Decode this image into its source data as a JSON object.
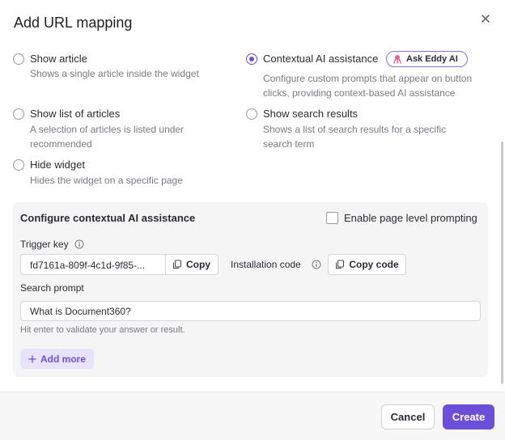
{
  "dialog": {
    "title": "Add URL mapping",
    "close_icon": "close-icon"
  },
  "options": [
    {
      "title": "Show article",
      "desc": "Shows a single article inside the widget",
      "selected": false
    },
    {
      "title": "Contextual AI assistance",
      "desc": "Configure custom prompts that appear on button clicks, providing context-based AI assistance",
      "selected": true
    },
    {
      "title": "Show list of articles",
      "desc": "A selection of articles is listed under recommended",
      "selected": false
    },
    {
      "title": "Show search results",
      "desc": "Shows a list of search results for a specific search term",
      "selected": false
    },
    {
      "title": "Hide widget",
      "desc": "Hides the widget on a specific page",
      "selected": false
    }
  ],
  "badge": {
    "label": "Ask Eddy AI",
    "icon": "eddy-ai-icon"
  },
  "panel": {
    "title": "Configure contextual AI assistance",
    "page_level_label": "Enable page level prompting",
    "page_level_checked": false,
    "trigger_key_label": "Trigger key",
    "trigger_key_value": "fd7161a-809f-4c1d-9f85-...",
    "copy_label": "Copy",
    "installation_code_label": "Installation code",
    "copy_code_label": "Copy code",
    "search_prompt_label": "Search prompt",
    "search_prompt_value": "What is Document360?",
    "hint": "Hit enter to validate your answer or result.",
    "add_more_label": "Add more"
  },
  "footer": {
    "cancel_label": "Cancel",
    "create_label": "Create"
  },
  "colors": {
    "accent": "#6b4fd8",
    "accent_light": "#e9e2fb",
    "panel_bg": "#f5f5f6"
  }
}
